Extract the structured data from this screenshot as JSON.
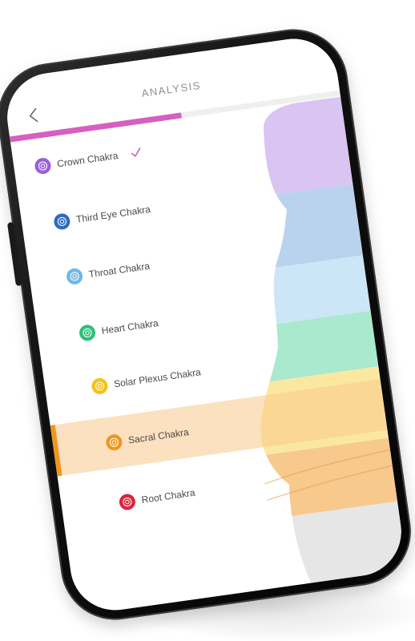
{
  "header": {
    "title": "ANALYSIS"
  },
  "progress": {
    "fraction": 0.52,
    "color": "#d65fc0"
  },
  "chakras": [
    {
      "label": "Crown Chakra",
      "color": "#9b5fd6",
      "icon": "crown-chakra-icon",
      "completed": true,
      "selected": false,
      "band": "#d9c4f2"
    },
    {
      "label": "Third Eye Chakra",
      "color": "#2e6bc0",
      "icon": "third-eye-chakra-icon",
      "completed": false,
      "selected": false,
      "band": "#b9d3ee"
    },
    {
      "label": "Throat Chakra",
      "color": "#6fb7e8",
      "icon": "throat-chakra-icon",
      "completed": false,
      "selected": false,
      "band": "#cce5f7"
    },
    {
      "label": "Heart Chakra",
      "color": "#2fbf7a",
      "icon": "heart-chakra-icon",
      "completed": false,
      "selected": false,
      "band": "#a9e9cd"
    },
    {
      "label": "Solar Plexus Chakra",
      "color": "#f2c31c",
      "icon": "solar-plexus-chakra-icon",
      "completed": false,
      "selected": false,
      "band": "#fbe8a0"
    },
    {
      "label": "Sacral Chakra",
      "color": "#f0961f",
      "icon": "sacral-chakra-icon",
      "completed": false,
      "selected": true,
      "band": "#f7c98d"
    },
    {
      "label": "Root Chakra",
      "color": "#d9273c",
      "icon": "root-chakra-icon",
      "completed": false,
      "selected": false,
      "band": "#e6e6e6"
    }
  ],
  "icons": {
    "back": "chevron-left-icon",
    "check": "check-icon"
  },
  "colors": {
    "accent": "#d65fc0",
    "check": "#d65fc0",
    "selected_marker": "#f0961f"
  }
}
